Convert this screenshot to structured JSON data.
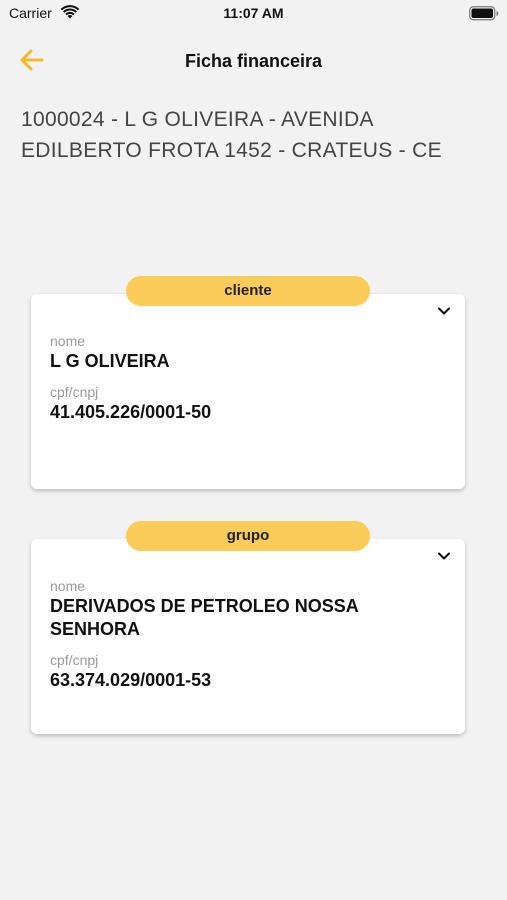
{
  "status_bar": {
    "carrier": "Carrier",
    "time": "11:07 AM"
  },
  "nav": {
    "title": "Ficha financeira"
  },
  "header": {
    "address": "1000024 - L G OLIVEIRA - AVENIDA EDILBERTO FROTA 1452 - CRATEUS  - CE"
  },
  "cards": [
    {
      "tag": "cliente",
      "fields": [
        {
          "label": "nome",
          "value": "L G OLIVEIRA"
        },
        {
          "label": "cpf/cnpj",
          "value": "41.405.226/0001-50"
        }
      ]
    },
    {
      "tag": "grupo",
      "fields": [
        {
          "label": "nome",
          "value": "DERIVADOS DE PETROLEO NOSSA SENHORA"
        },
        {
          "label": "cpf/cnpj",
          "value": "63.374.029/0001-53"
        }
      ]
    }
  ],
  "colors": {
    "accent": "#fccc5a",
    "back_arrow": "#f5b92f",
    "background": "#f2f2f2"
  },
  "icons": {
    "back": "arrow-left-icon",
    "expand": "chevron-down-icon",
    "wifi": "wifi-icon",
    "battery": "battery-icon"
  }
}
